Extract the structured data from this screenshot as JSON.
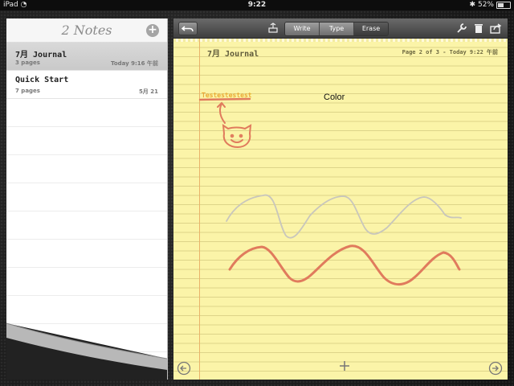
{
  "status_bar": {
    "device": "iPad",
    "time": "9:22",
    "battery": "52%",
    "battery_level": 0.52
  },
  "notes_list": {
    "title": "2 Notes",
    "add_icon": "plus-circle-icon",
    "items": [
      {
        "title": "7月 Journal",
        "pages": "3 pages",
        "date": "Today 9:16 午前",
        "selected": true
      },
      {
        "title": "Quick Start",
        "pages": "7 pages",
        "date": "5月 21",
        "selected": false
      }
    ]
  },
  "toolbar": {
    "undo_icon": "undo-icon",
    "mode_icon": "stamp-icon",
    "modes": [
      "Write",
      "Type",
      "Erase"
    ],
    "active_mode": "Erase",
    "tools": [
      "wrench-icon",
      "trash-icon",
      "share-icon"
    ]
  },
  "page": {
    "title": "7月 Journal",
    "info": "Page 2 of 3 - Today 9:22 午前",
    "typed_text": "Color",
    "handwritten_text": "Testestestest"
  },
  "colors": {
    "paper": "#fbf4a8",
    "ink_red": "#e07b5d",
    "ink_gray": "#c8c6bc",
    "ink_yellow": "#f0c419"
  }
}
